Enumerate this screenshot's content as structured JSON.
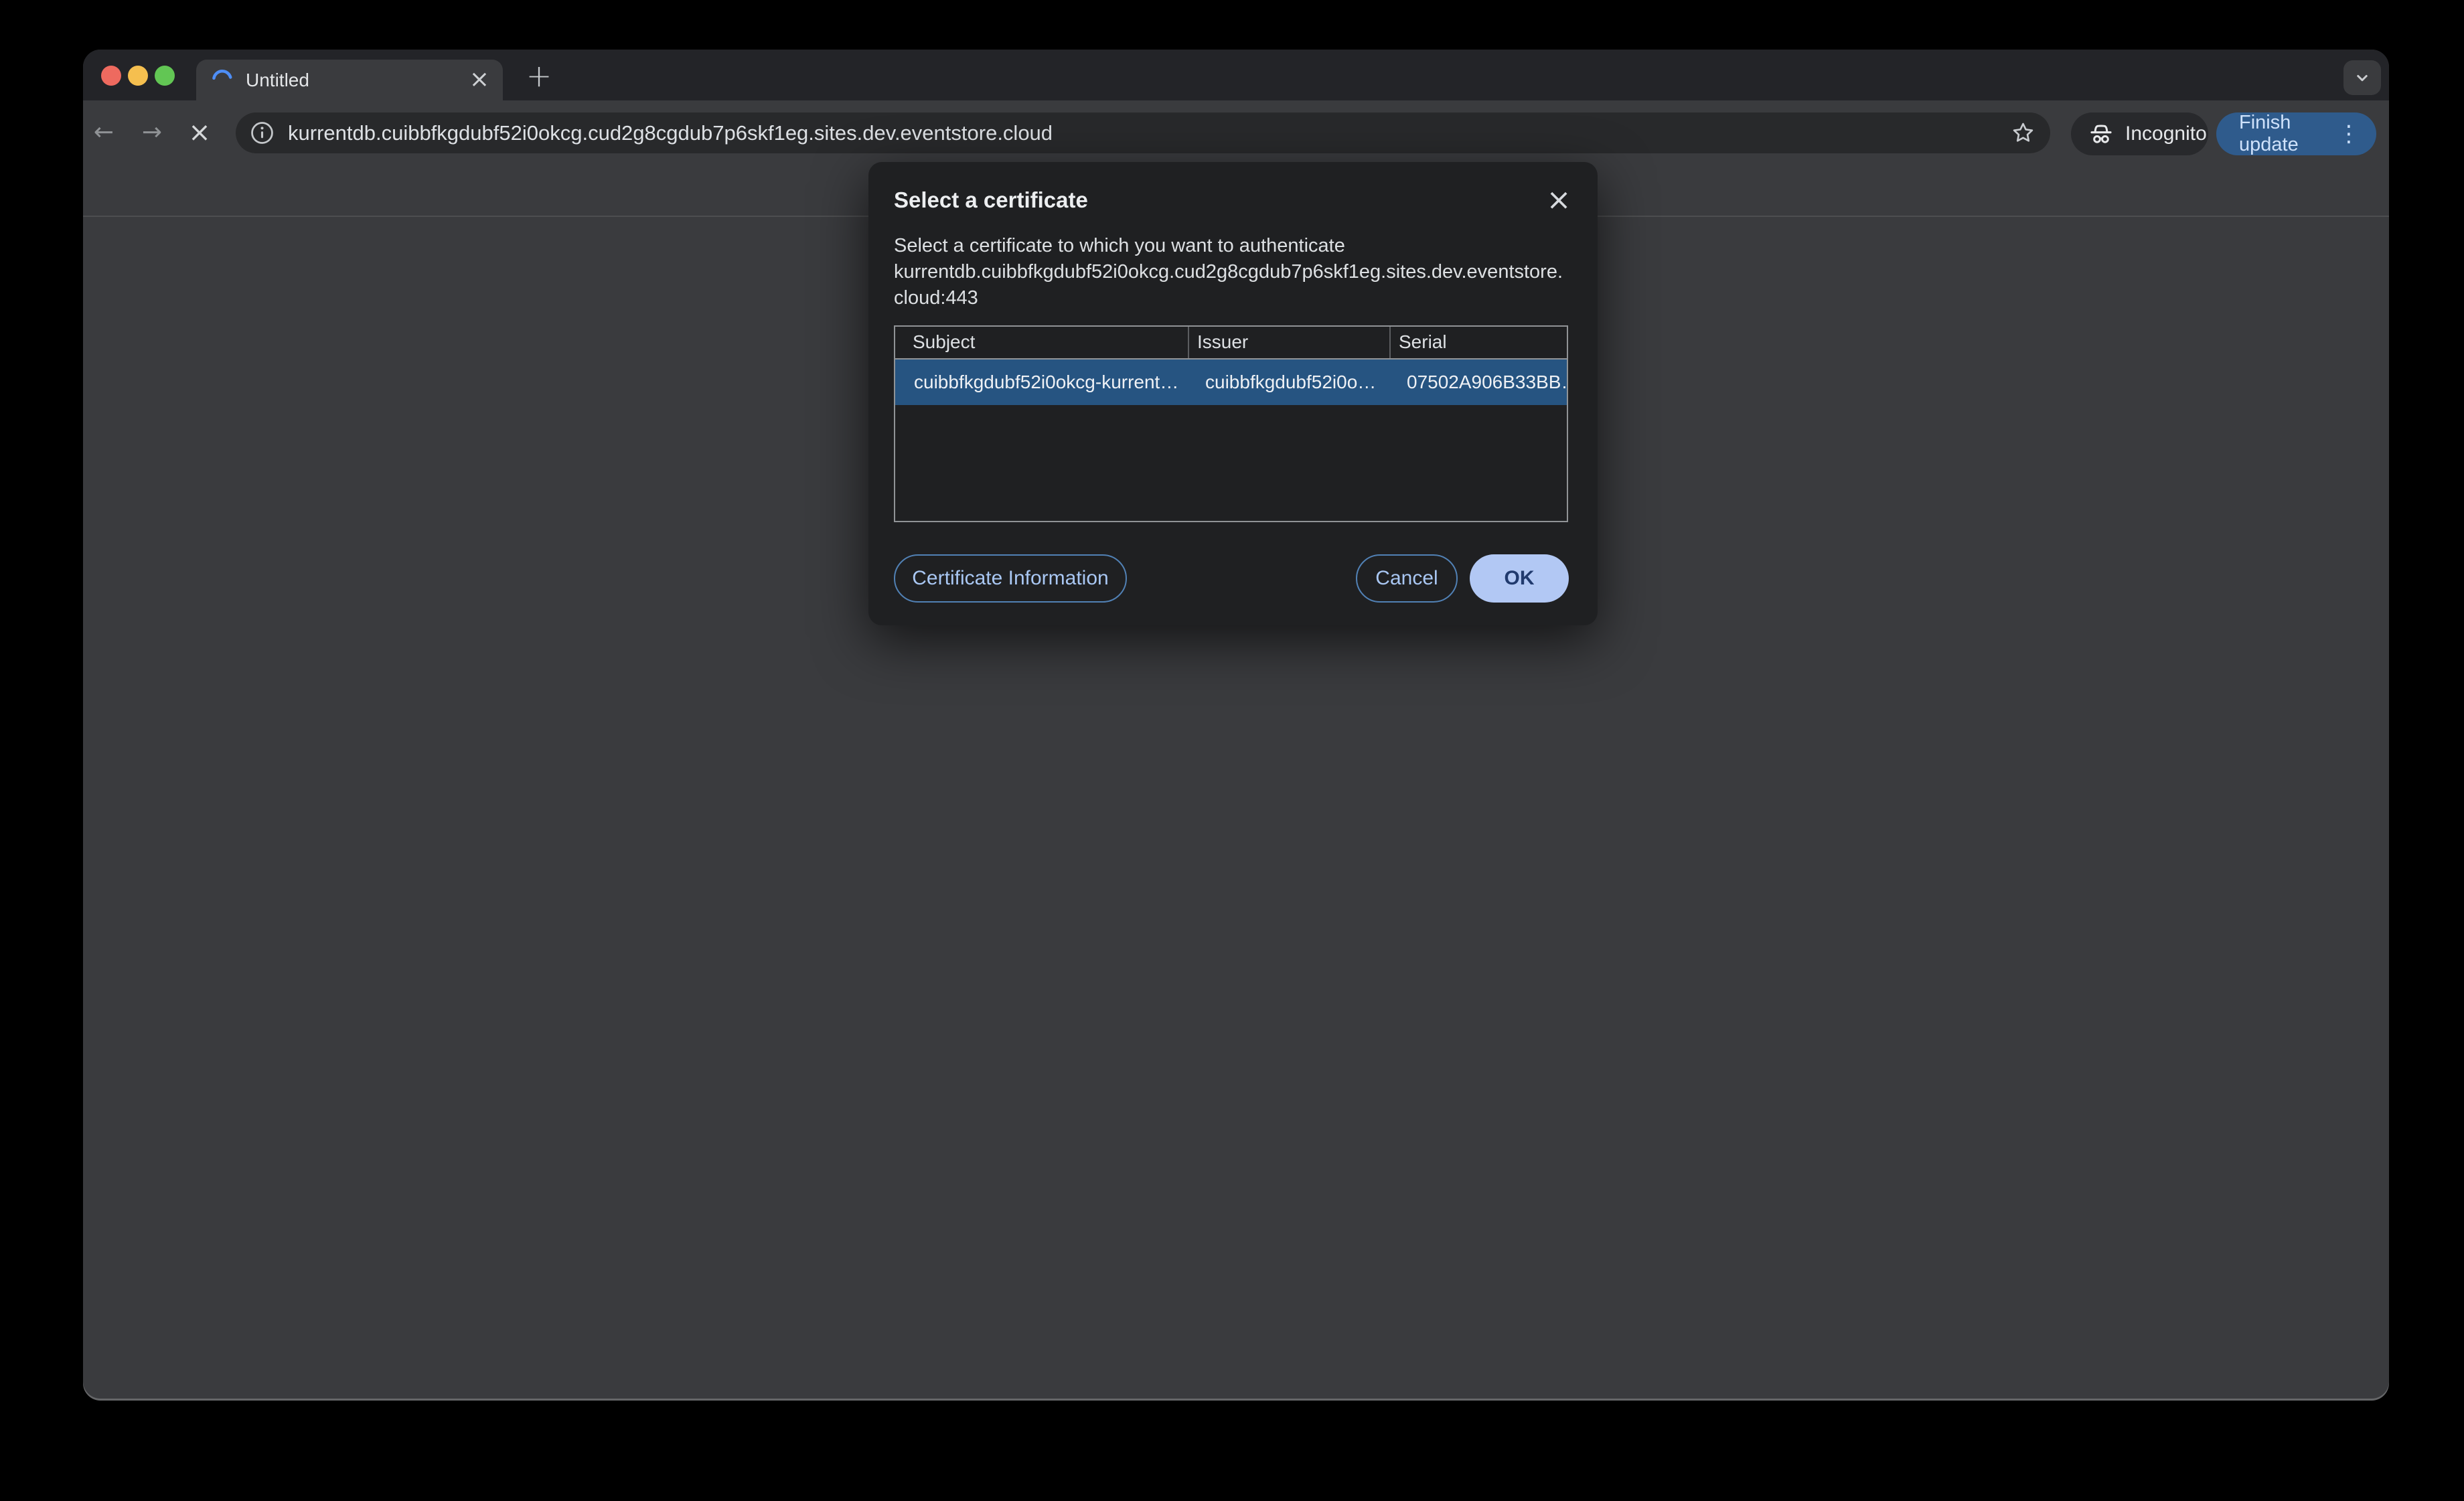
{
  "browser": {
    "tab": {
      "title": "Untitled"
    },
    "new_tab_button": "+",
    "window_menu_icon": "chevron-down",
    "nav": {
      "back": "←",
      "forward": "→",
      "stop": "×"
    },
    "omnibox": {
      "url": "kurrentdb.cuibbfkgdubf52i0okcg.cud2g8cgdub7p6skf1eg.sites.dev.eventstore.cloud",
      "site_info_icon": "info-circle",
      "bookmark_icon": "star-outline"
    },
    "incognito_badge": "Incognito",
    "update_button": {
      "label": "Finish update",
      "menu_icon": "⋮"
    }
  },
  "dialog": {
    "title": "Select a certificate",
    "close_icon": "×",
    "message": "Select a certificate to which you want to authenticate kurrentdb.cuibbfkgdubf52i0okcg.cud2g8cgdub7p6skf1eg.sites.dev.eventstore.cloud:443",
    "table": {
      "columns": [
        "Subject",
        "Issuer",
        "Serial"
      ],
      "rows": [
        {
          "subject": "cuibbfkgdubf52i0okcg-kurrent…",
          "issuer": "cuibbfkgdubf52i0o…",
          "serial": "07502A906B33BB…",
          "selected": true
        }
      ]
    },
    "buttons": {
      "info": "Certificate Information",
      "cancel": "Cancel",
      "ok": "OK"
    }
  },
  "colors": {
    "selection_blue": "#265481",
    "button_accent": "#a9c7f3",
    "ok_fill": "#b2c8f4",
    "ok_text": "#203a6e",
    "update_pill": "#2f5b8c",
    "dialog_bg": "#1f2022",
    "window_bg": "#3a3b3e",
    "tabstrip_bg": "#232428",
    "omnibox_bg": "#28292b",
    "traffic_red": "#ee6a5f",
    "traffic_yellow": "#f5bf4f",
    "traffic_green": "#62c654"
  }
}
